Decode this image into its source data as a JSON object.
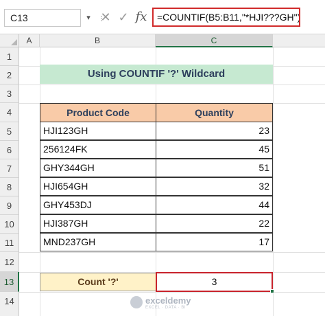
{
  "formula_bar": {
    "name_box": "C13",
    "formula": "=COUNTIF(B5:B11,\"*HJI???GH\")"
  },
  "columns": [
    "A",
    "B",
    "C"
  ],
  "rows": [
    "1",
    "2",
    "3",
    "4",
    "5",
    "6",
    "7",
    "8",
    "9",
    "10",
    "11",
    "12",
    "13",
    "14"
  ],
  "sheet": {
    "title": "Using COUNTIF '?' Wildcard",
    "table": {
      "headers": [
        "Product Code",
        "Quantity"
      ],
      "rows": [
        {
          "code": "HJI123GH",
          "qty": "23"
        },
        {
          "code": "256124FK",
          "qty": "45"
        },
        {
          "code": "GHY344GH",
          "qty": "51"
        },
        {
          "code": "HJI654GH",
          "qty": "32"
        },
        {
          "code": "GHY453DJ",
          "qty": "44"
        },
        {
          "code": "HJI387GH",
          "qty": "22"
        },
        {
          "code": "MND237GH",
          "qty": "17"
        }
      ]
    },
    "count_label": "Count  '?'",
    "count_value": "3"
  },
  "watermark": {
    "brand": "exceldemy",
    "tagline": "EXCEL · DATA · BI"
  },
  "colors": {
    "title_bg": "#c6e9d1",
    "header_bg": "#f9cba8",
    "count_bg": "#fff2c8",
    "highlight": "#d12b2b",
    "excel_green": "#217346"
  }
}
